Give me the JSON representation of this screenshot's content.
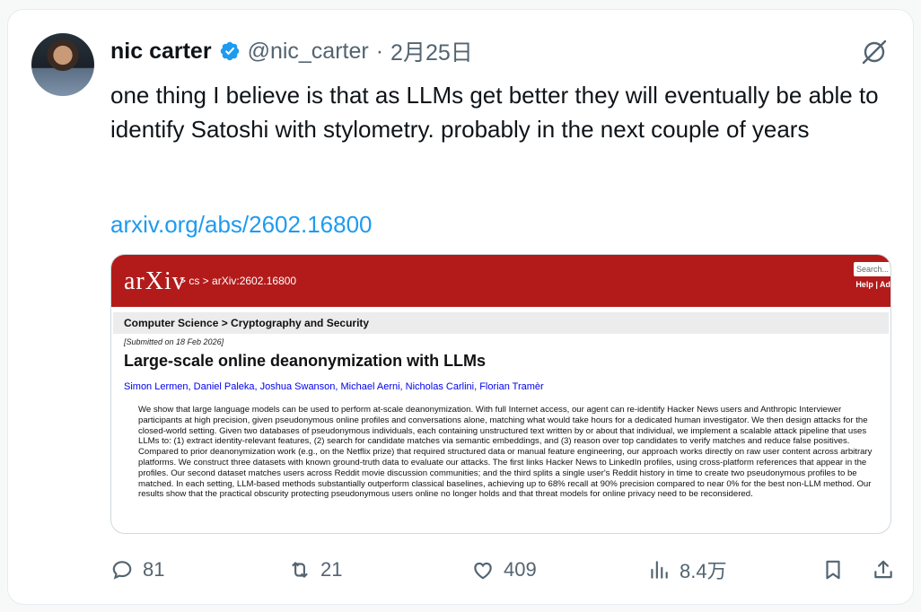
{
  "tweet": {
    "author_name": "nic carter",
    "handle": "@nic_carter",
    "separator": "·",
    "date": "2月25日",
    "text": "one thing I believe is that as LLMs get better they will eventually be able to identify Satoshi with stylometry. probably in the next couple of years",
    "link": "arxiv.org/abs/2602.16800"
  },
  "embed": {
    "logo": "arXiv",
    "breadcrumb": "> cs > arXiv:2602.16800",
    "search_placeholder": "Search...",
    "help_label": "Help | Ad",
    "subject": "Computer Science > Cryptography and Security",
    "submitted": "[Submitted on 18 Feb 2026]",
    "title": "Large-scale online deanonymization with LLMs",
    "authors": "Simon Lermen, Daniel Paleka, Joshua Swanson, Michael Aerni, Nicholas Carlini, Florian Tramèr",
    "abstract": "We show that large language models can be used to perform at-scale deanonymization. With full Internet access, our agent can re-identify Hacker News users and Anthropic Interviewer participants at high precision, given pseudonymous online profiles and conversations alone, matching what would take hours for a dedicated human investigator. We then design attacks for the closed-world setting. Given two databases of pseudonymous individuals, each containing unstructured text written by or about that individual, we implement a scalable attack pipeline that uses LLMs to: (1) extract identity-relevant features, (2) search for candidate matches via semantic embeddings, and (3) reason over top candidates to verify matches and reduce false positives. Compared to prior deanonymization work (e.g., on the Netflix prize) that required structured data or manual feature engineering, our approach works directly on raw user content across arbitrary platforms. We construct three datasets with known ground-truth data to evaluate our attacks. The first links Hacker News to LinkedIn profiles, using cross-platform references that appear in the profiles. Our second dataset matches users across Reddit movie discussion communities; and the third splits a single user's Reddit history in time to create two pseudonymous profiles to be matched. In each setting, LLM-based methods substantially outperform classical baselines, achieving up to 68% recall at 90% precision compared to near 0% for the best non-LLM method. Our results show that the practical obscurity protecting pseudonymous users online no longer holds and that threat models for online privacy need to be reconsidered."
  },
  "actions": {
    "replies": "81",
    "retweets": "21",
    "likes": "409",
    "views": "8.4万"
  },
  "colors": {
    "link": "#1d9bf0",
    "verified": "#1d9bf0",
    "arxiv_red": "#b31b1b",
    "muted": "#536471"
  }
}
